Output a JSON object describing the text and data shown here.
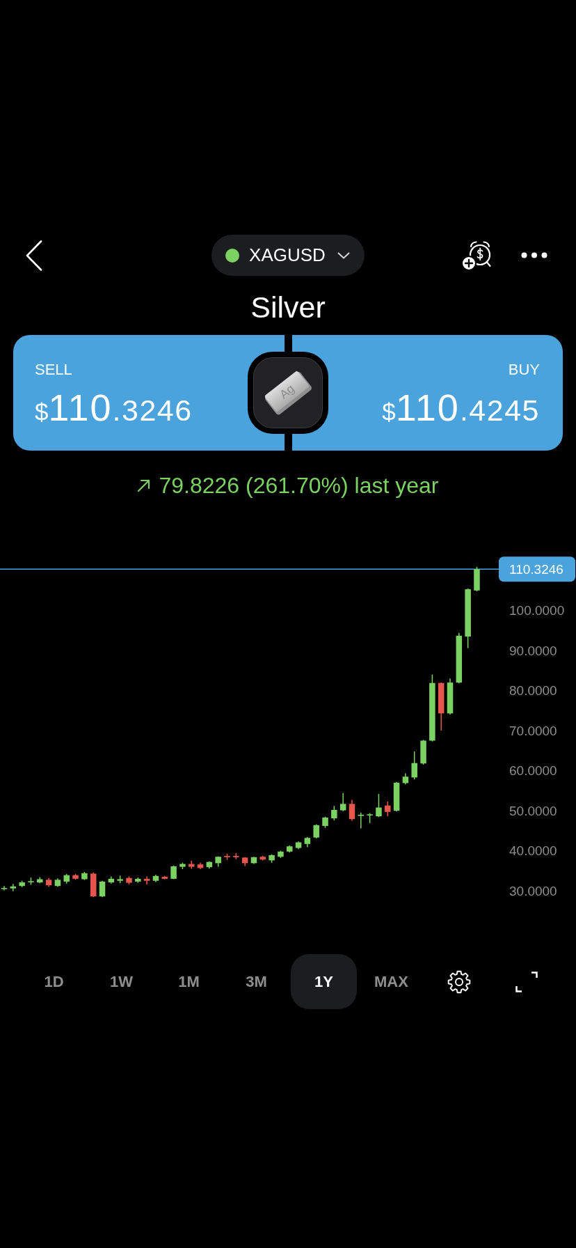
{
  "header": {
    "symbol": "XAGUSD"
  },
  "title": "Silver",
  "quote": {
    "sides": [
      {
        "kind": "sell",
        "label": "SELL",
        "currency": "$",
        "whole": "110",
        "fraction": ".3246"
      },
      {
        "kind": "buy",
        "label": "BUY",
        "currency": "$",
        "whole": "110",
        "fraction": ".4245"
      }
    ],
    "asset_mark": "Ag"
  },
  "change": {
    "rising": true,
    "text": "79.8226 (261.70%) last year"
  },
  "chart": {
    "chart_data": {
      "type": "candlestick",
      "ohlc": [
        [
          30.6,
          31.2,
          30.1,
          30.7
        ],
        [
          30.6,
          31.7,
          29.9,
          31.1
        ],
        [
          31.2,
          32.5,
          30.9,
          32.1
        ],
        [
          32.2,
          33.3,
          31.5,
          32.4
        ],
        [
          32.1,
          33.4,
          31.9,
          32.9
        ],
        [
          32.75,
          33.2,
          31.0,
          31.4
        ],
        [
          31.2,
          33.1,
          31.0,
          32.75
        ],
        [
          32.3,
          34.2,
          31.8,
          33.9
        ],
        [
          33.9,
          34.2,
          32.8,
          33.0
        ],
        [
          32.9,
          34.7,
          32.7,
          34.4
        ],
        [
          34.3,
          34.6,
          28.4,
          28.6
        ],
        [
          28.6,
          32.5,
          28.4,
          32.3
        ],
        [
          32.1,
          33.6,
          31.8,
          33.0
        ],
        [
          32.5,
          33.8,
          31.9,
          32.9
        ],
        [
          33.2,
          33.6,
          31.6,
          32.0
        ],
        [
          32.3,
          33.3,
          32.0,
          33.0
        ],
        [
          33.0,
          33.6,
          31.6,
          32.5
        ],
        [
          32.5,
          34.0,
          32.2,
          33.7
        ],
        [
          33.5,
          33.7,
          32.9,
          33.0
        ],
        [
          33.0,
          36.3,
          32.9,
          36.1
        ],
        [
          36.0,
          37.0,
          35.4,
          36.7
        ],
        [
          36.7,
          37.5,
          35.5,
          36.0
        ],
        [
          36.6,
          37.0,
          35.4,
          35.7
        ],
        [
          35.9,
          37.3,
          35.6,
          37.2
        ],
        [
          36.9,
          38.6,
          36.0,
          38.5
        ],
        [
          38.7,
          39.3,
          37.7,
          38.4
        ],
        [
          38.7,
          39.4,
          37.9,
          38.4
        ],
        [
          38.3,
          38.4,
          36.2,
          36.9
        ],
        [
          36.9,
          38.5,
          36.7,
          38.4
        ],
        [
          38.5,
          38.7,
          37.6,
          37.8
        ],
        [
          37.6,
          39.1,
          37.0,
          38.9
        ],
        [
          38.5,
          40.0,
          38.2,
          39.8
        ],
        [
          39.8,
          41.3,
          39.6,
          41.1
        ],
        [
          40.7,
          42.3,
          40.4,
          42.1
        ],
        [
          41.7,
          43.4,
          40.9,
          43.2
        ],
        [
          43.3,
          46.6,
          43.1,
          46.4
        ],
        [
          46.2,
          48.5,
          45.7,
          48.3
        ],
        [
          48.1,
          51.2,
          47.6,
          50.2
        ],
        [
          50.1,
          54.4,
          49.9,
          51.7
        ],
        [
          51.7,
          52.7,
          47.5,
          47.9
        ],
        [
          48.7,
          49.5,
          45.6,
          49.0
        ],
        [
          48.9,
          49.4,
          46.9,
          49.1
        ],
        [
          48.6,
          54.2,
          48.4,
          50.8
        ],
        [
          51.3,
          52.3,
          48.6,
          49.7
        ],
        [
          50.0,
          57.2,
          49.8,
          57.0
        ],
        [
          56.9,
          59.3,
          56.6,
          58.5
        ],
        [
          58.3,
          64.8,
          57.8,
          61.9
        ],
        [
          61.8,
          67.7,
          61.5,
          67.5
        ],
        [
          67.5,
          84.0,
          67.3,
          81.9
        ],
        [
          81.9,
          82.0,
          70.0,
          74.3
        ],
        [
          74.3,
          83.0,
          74.0,
          82.0
        ],
        [
          82.0,
          94.4,
          81.8,
          93.7
        ],
        [
          93.5,
          105.5,
          90.6,
          105.3
        ],
        [
          105.0,
          110.9,
          104.8,
          110.3246
        ]
      ],
      "ylim": [
        30,
        110.3246
      ],
      "yticks": [
        {
          "value": 110.3246,
          "label": "110.3246"
        },
        {
          "value": 100,
          "label": "100.0000"
        },
        {
          "value": 90,
          "label": "90.0000"
        },
        {
          "value": 80,
          "label": "80.0000"
        },
        {
          "value": 70,
          "label": "70.0000"
        },
        {
          "value": 60,
          "label": "60.0000"
        },
        {
          "value": 50,
          "label": "50.0000"
        },
        {
          "value": 40,
          "label": "40.0000"
        },
        {
          "value": 30,
          "label": "30.0000"
        }
      ]
    }
  },
  "ranges": [
    {
      "label": "1D",
      "selected": false
    },
    {
      "label": "1W",
      "selected": false
    },
    {
      "label": "1M",
      "selected": false
    },
    {
      "label": "3M",
      "selected": false
    },
    {
      "label": "1Y",
      "selected": true
    },
    {
      "label": "MAX",
      "selected": false
    }
  ]
}
